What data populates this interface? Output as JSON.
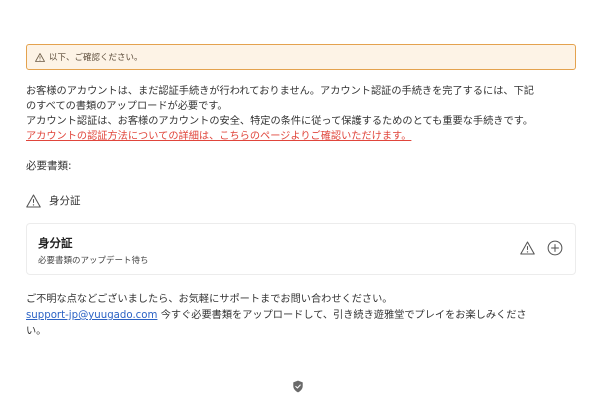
{
  "alert": {
    "text": "以下、ご確認ください。",
    "icon": "warning-icon",
    "border_color": "#e4a24e",
    "bg_color": "#fdf3e6"
  },
  "intro": {
    "line1": "お客様のアカウントは、まだ認証手続きが行われておりません。アカウント認証の手続きを完了するには、下記",
    "line2": "のすべての書類のアップロードが必要です。",
    "line3": "アカウント認証は、お客様のアカウントの安全、特定の条件に従って保護するためのとても重要な手続きです。",
    "link": "アカウントの認証方法についての詳細は、こちらのページよりご確認いただけます。",
    "link_color": "#e0453b"
  },
  "required_docs_label": "必要書類:",
  "doc_summary": {
    "label": "身分証",
    "icon": "warning-icon"
  },
  "card": {
    "title": "身分証",
    "subtitle": "必要書類のアップデート待ち",
    "status_icon": "warning-icon",
    "action_icon": "add-circle-icon"
  },
  "footer": {
    "line1": "ご不明な点などございましたら、お気軽にサポートまでお問い合わせください。",
    "email": "support-jp@yuugado.com",
    "line2_rest": " 今すぐ必要書類をアップロードして、引き続き遊雅堂でプレイをお楽しみくださ",
    "line3": "い。",
    "email_color": "#2b62c4"
  },
  "bottom_icon": "shield-check-icon"
}
